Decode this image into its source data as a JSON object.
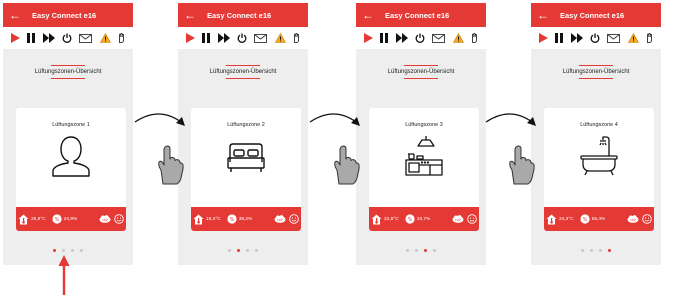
{
  "app": {
    "title": "Easy Connect e16"
  },
  "overview_title": "Lüftungszonen-Übersicht",
  "icons": {
    "back": "arrow-left-icon",
    "toolbar": [
      "play-icon",
      "pause-icon",
      "fast-forward-icon",
      "power-icon",
      "mail-icon",
      "warning-icon",
      "hand-icon"
    ],
    "status": [
      "temperature-home-icon",
      "humidity-icon",
      "co2-icon",
      "smiley-icon"
    ]
  },
  "colors": {
    "accent": "#e53935",
    "warning": "#f9a825",
    "background": "#eeeeee",
    "dot_inactive": "#c8c8c8"
  },
  "labels": {
    "co2": "co2"
  },
  "screens": [
    {
      "zone_name": "Lüftungszone 1",
      "icon": "person-icon",
      "temperature": "25,8°C",
      "humidity": "24,9%",
      "active_dot": 0
    },
    {
      "zone_name": "Lüftungszone 2",
      "icon": "bed-icon",
      "temperature": "18,4°C",
      "humidity": "39,2%",
      "active_dot": 1
    },
    {
      "zone_name": "Lüftungszone 3",
      "icon": "kitchen-icon",
      "temperature": "22,8°C",
      "humidity": "33,7%",
      "active_dot": 2
    },
    {
      "zone_name": "Lüftungszone 4",
      "icon": "bathtub-icon",
      "temperature": "24,3°C",
      "humidity": "55,4%",
      "active_dot": 3
    }
  ]
}
